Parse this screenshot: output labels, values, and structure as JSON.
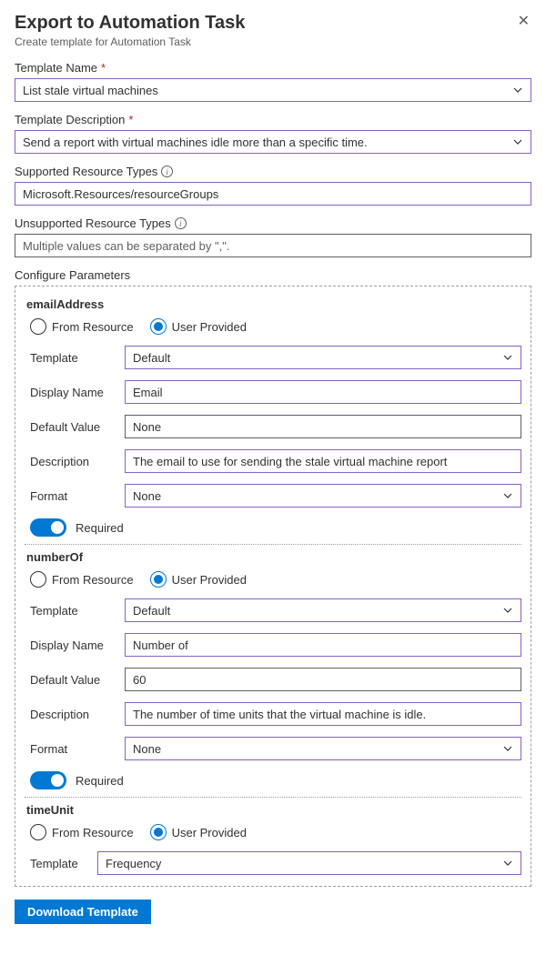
{
  "header": {
    "title": "Export to Automation Task",
    "subtitle": "Create template for Automation Task"
  },
  "fields": {
    "templateName": {
      "label": "Template Name",
      "value": "List stale virtual machines"
    },
    "templateDescription": {
      "label": "Template Description",
      "value": "Send a report with virtual machines idle more than a specific time."
    },
    "supported": {
      "label": "Supported Resource Types",
      "value": "Microsoft.Resources/resourceGroups"
    },
    "unsupported": {
      "label": "Unsupported Resource Types",
      "placeholder": "Multiple values can be separated by \",\"."
    }
  },
  "configureLabel": "Configure Parameters",
  "radioLabels": {
    "fromResource": "From Resource",
    "userProvided": "User Provided"
  },
  "paramLabels": {
    "template": "Template",
    "displayName": "Display Name",
    "defaultValue": "Default Value",
    "description": "Description",
    "format": "Format",
    "required": "Required"
  },
  "params": {
    "emailAddress": {
      "name": "emailAddress",
      "template": "Default",
      "displayName": "Email",
      "defaultValue": "None",
      "description": "The email to use for sending the stale virtual machine report",
      "format": "None"
    },
    "numberOf": {
      "name": "numberOf",
      "template": "Default",
      "displayName": "Number of",
      "defaultValue": "60",
      "description": "The number of time units that the virtual machine is idle.",
      "format": "None"
    },
    "timeUnit": {
      "name": "timeUnit",
      "template": "Frequency"
    }
  },
  "footer": {
    "downloadLabel": "Download Template"
  }
}
